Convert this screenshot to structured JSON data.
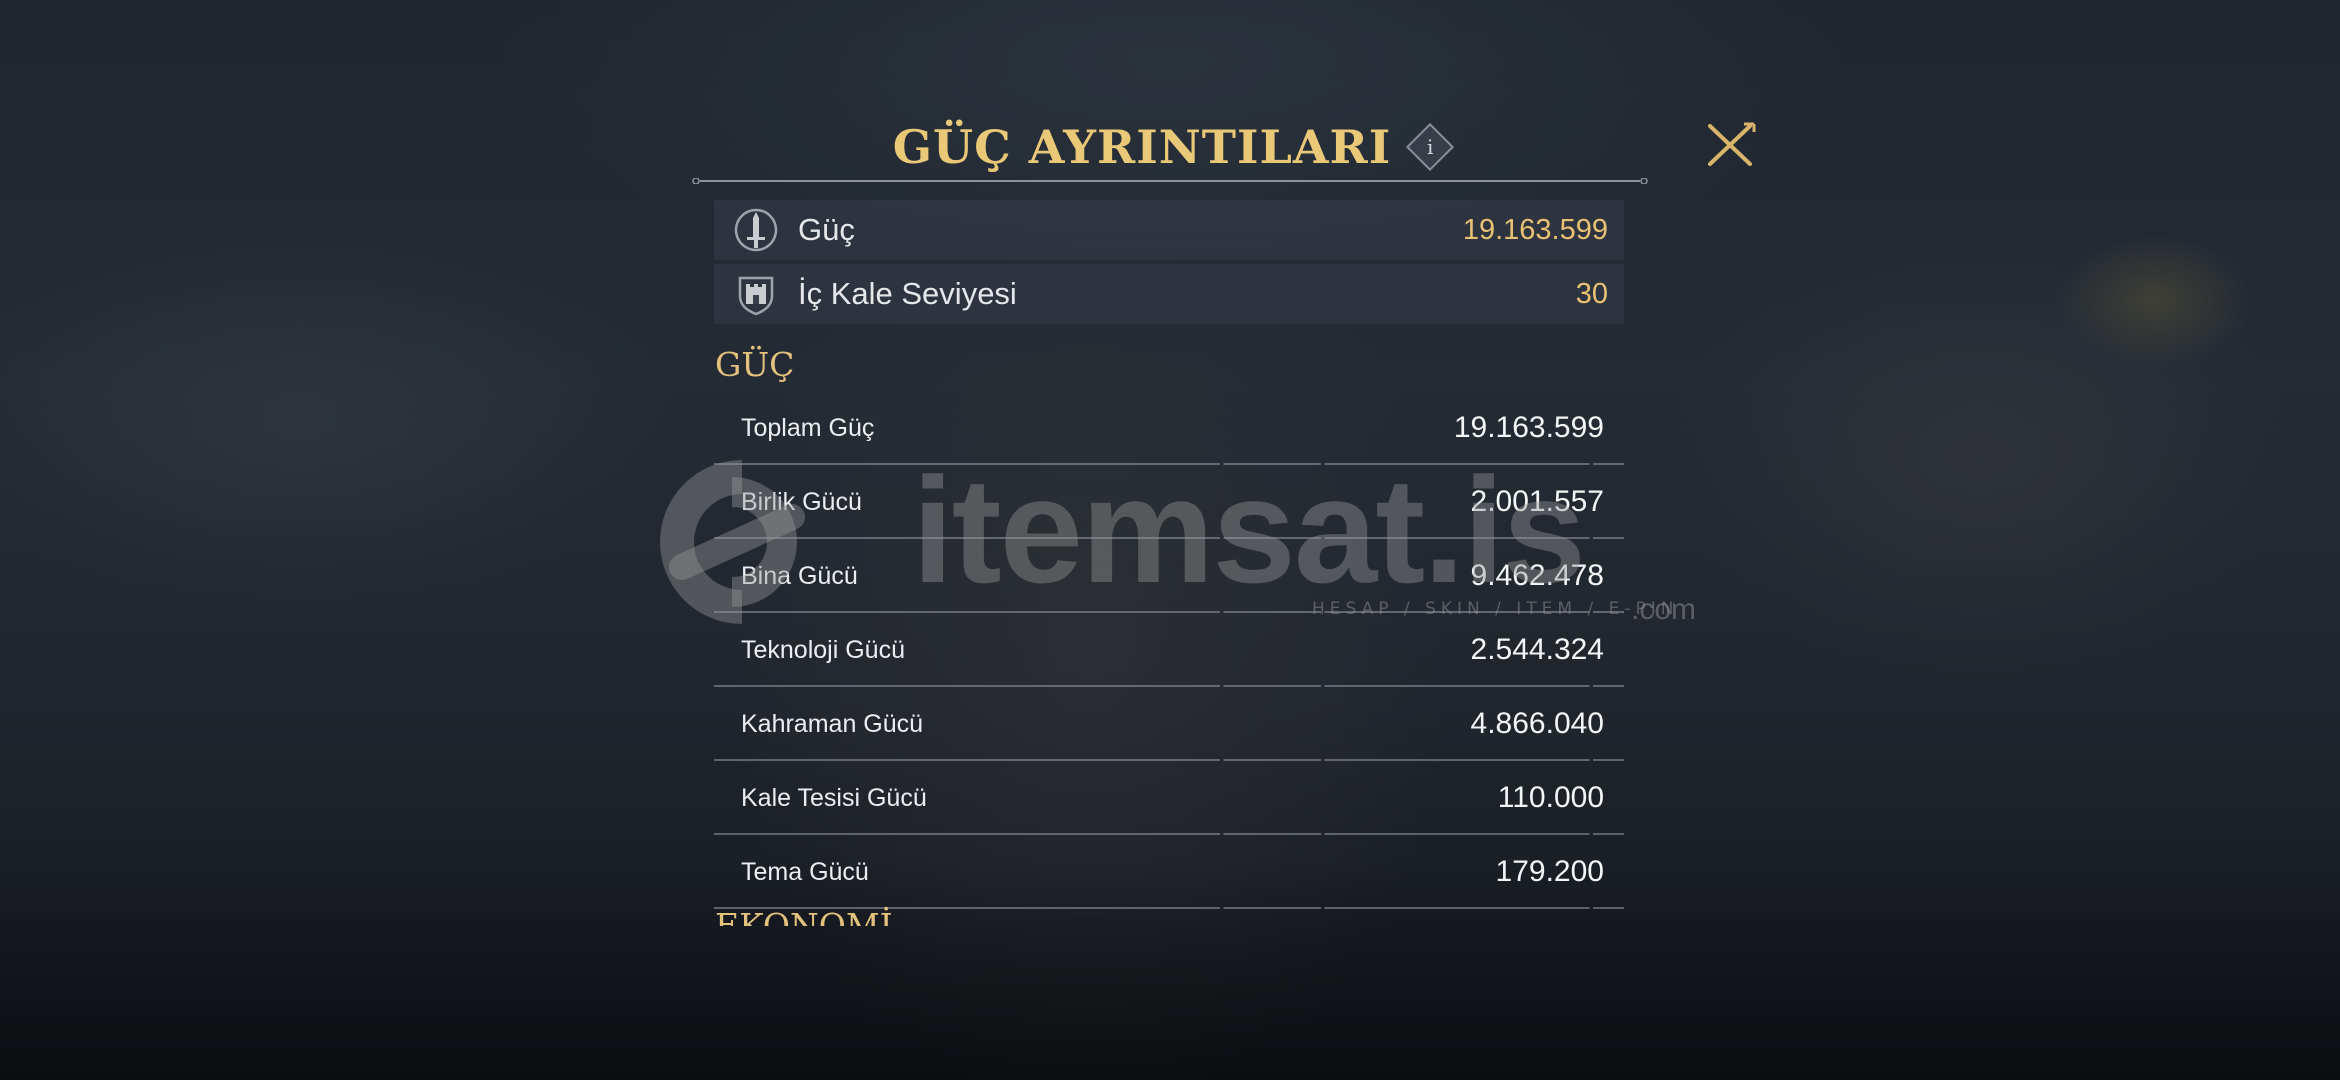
{
  "header": {
    "title": "GÜÇ AYRINTILARI",
    "info_icon": "i"
  },
  "summary": [
    {
      "label": "Güç",
      "value": "19.163.599",
      "icon": "sword-icon"
    },
    {
      "label": "İç Kale Seviyesi",
      "value": "30",
      "icon": "castle-shield-icon"
    }
  ],
  "sections": {
    "power": {
      "title": "GÜÇ",
      "rows": [
        {
          "label": "Toplam Güç",
          "value": "19.163.599"
        },
        {
          "label": "Birlik Gücü",
          "value": "2.001.557"
        },
        {
          "label": "Bina Gücü",
          "value": "9.462.478"
        },
        {
          "label": "Teknoloji Gücü",
          "value": "2.544.324"
        },
        {
          "label": "Kahraman Gücü",
          "value": "4.866.040"
        },
        {
          "label": "Kale Tesisi Gücü",
          "value": "110.000"
        },
        {
          "label": "Tema Gücü",
          "value": "179.200"
        }
      ]
    },
    "economy": {
      "title": "EKONOMİ"
    }
  },
  "watermark": {
    "word": "itemsat.is",
    "sub": "HESAP / SKIN / ITEM / E-PIN",
    "suffix": ".com"
  },
  "colors": {
    "accent_gold": "#e9c878",
    "value_gold": "#e8c173",
    "text": "#eceef1"
  }
}
